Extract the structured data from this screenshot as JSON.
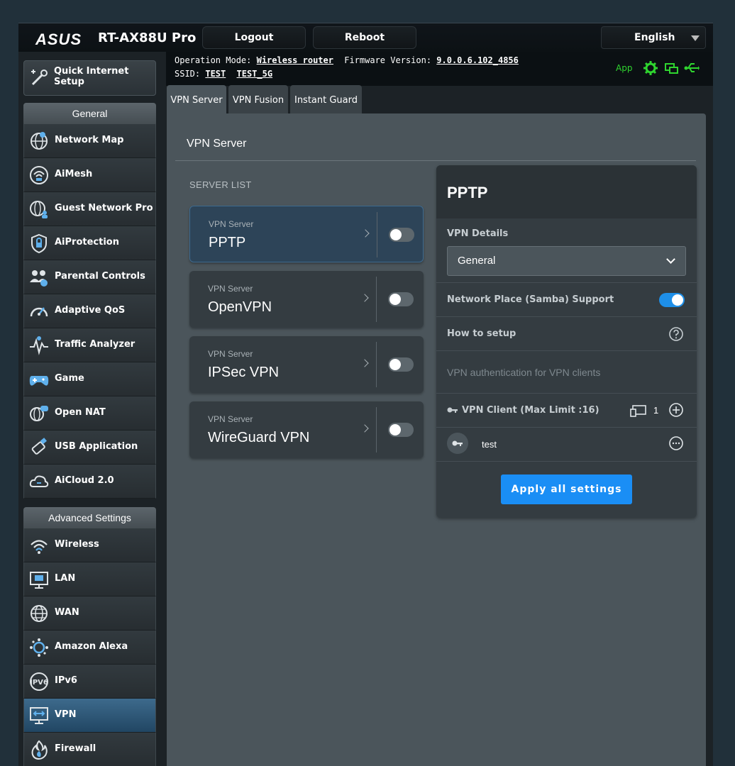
{
  "header": {
    "brand": "ASUS",
    "model": "RT-AX88U Pro",
    "logout_label": "Logout",
    "reboot_label": "Reboot",
    "language": "English"
  },
  "info": {
    "operation_mode_label": "Operation Mode:",
    "operation_mode_value": "Wireless router",
    "firmware_label": "Firmware Version:",
    "firmware_value": "9.0.0.6.102_4856",
    "ssid_label": "SSID:",
    "ssid_values": [
      "TEST",
      "TEST_5G"
    ],
    "app_label": "App"
  },
  "sidebar": {
    "quick_setup": "Quick Internet Setup",
    "general_heading": "General",
    "general_items": [
      {
        "label": "Network Map",
        "icon": "globe-icon"
      },
      {
        "label": "AiMesh",
        "icon": "aimesh-icon"
      },
      {
        "label": "Guest Network Pro",
        "icon": "guest-network-icon"
      },
      {
        "label": "AiProtection",
        "icon": "shield-lock-icon"
      },
      {
        "label": "Parental Controls",
        "icon": "family-icon"
      },
      {
        "label": "Adaptive QoS",
        "icon": "speedometer-icon"
      },
      {
        "label": "Traffic Analyzer",
        "icon": "pulse-icon"
      },
      {
        "label": "Game",
        "icon": "gamepad-icon"
      },
      {
        "label": "Open NAT",
        "icon": "open-nat-icon"
      },
      {
        "label": "USB Application",
        "icon": "usb-icon"
      },
      {
        "label": "AiCloud 2.0",
        "icon": "cloud-icon"
      }
    ],
    "advanced_heading": "Advanced Settings",
    "advanced_items": [
      {
        "label": "Wireless",
        "icon": "wifi-icon"
      },
      {
        "label": "LAN",
        "icon": "lan-icon"
      },
      {
        "label": "WAN",
        "icon": "wan-globe-icon"
      },
      {
        "label": "Amazon Alexa",
        "icon": "alexa-icon"
      },
      {
        "label": "IPv6",
        "icon": "ipv6-icon"
      },
      {
        "label": "VPN",
        "icon": "vpn-icon",
        "active": true
      },
      {
        "label": "Firewall",
        "icon": "fire-icon"
      }
    ]
  },
  "tabs": [
    "VPN Server",
    "VPN Fusion",
    "Instant Guard"
  ],
  "main": {
    "title": "VPN Server",
    "server_list_label": "SERVER LIST",
    "servers": [
      {
        "sub": "VPN Server",
        "name": "PPTP",
        "enabled": false
      },
      {
        "sub": "VPN Server",
        "name": "OpenVPN",
        "enabled": false
      },
      {
        "sub": "VPN Server",
        "name": "IPSec VPN",
        "enabled": false
      },
      {
        "sub": "VPN Server",
        "name": "WireGuard VPN",
        "enabled": false
      }
    ]
  },
  "detail": {
    "title": "PPTP",
    "vpn_details_label": "VPN Details",
    "select_value": "General",
    "samba_label": "Network Place (Samba) Support",
    "samba_enabled": true,
    "how_to_label": "How to setup",
    "auth_text": "VPN authentication for VPN clients",
    "client_label": "VPN Client (Max Limit :16)",
    "client_count": "1",
    "client_name": "test",
    "apply_label": "Apply all settings"
  },
  "colors": {
    "accent": "#1a8ef5",
    "active_nav": "#2d5a7e",
    "status_green": "#2fd52f"
  }
}
